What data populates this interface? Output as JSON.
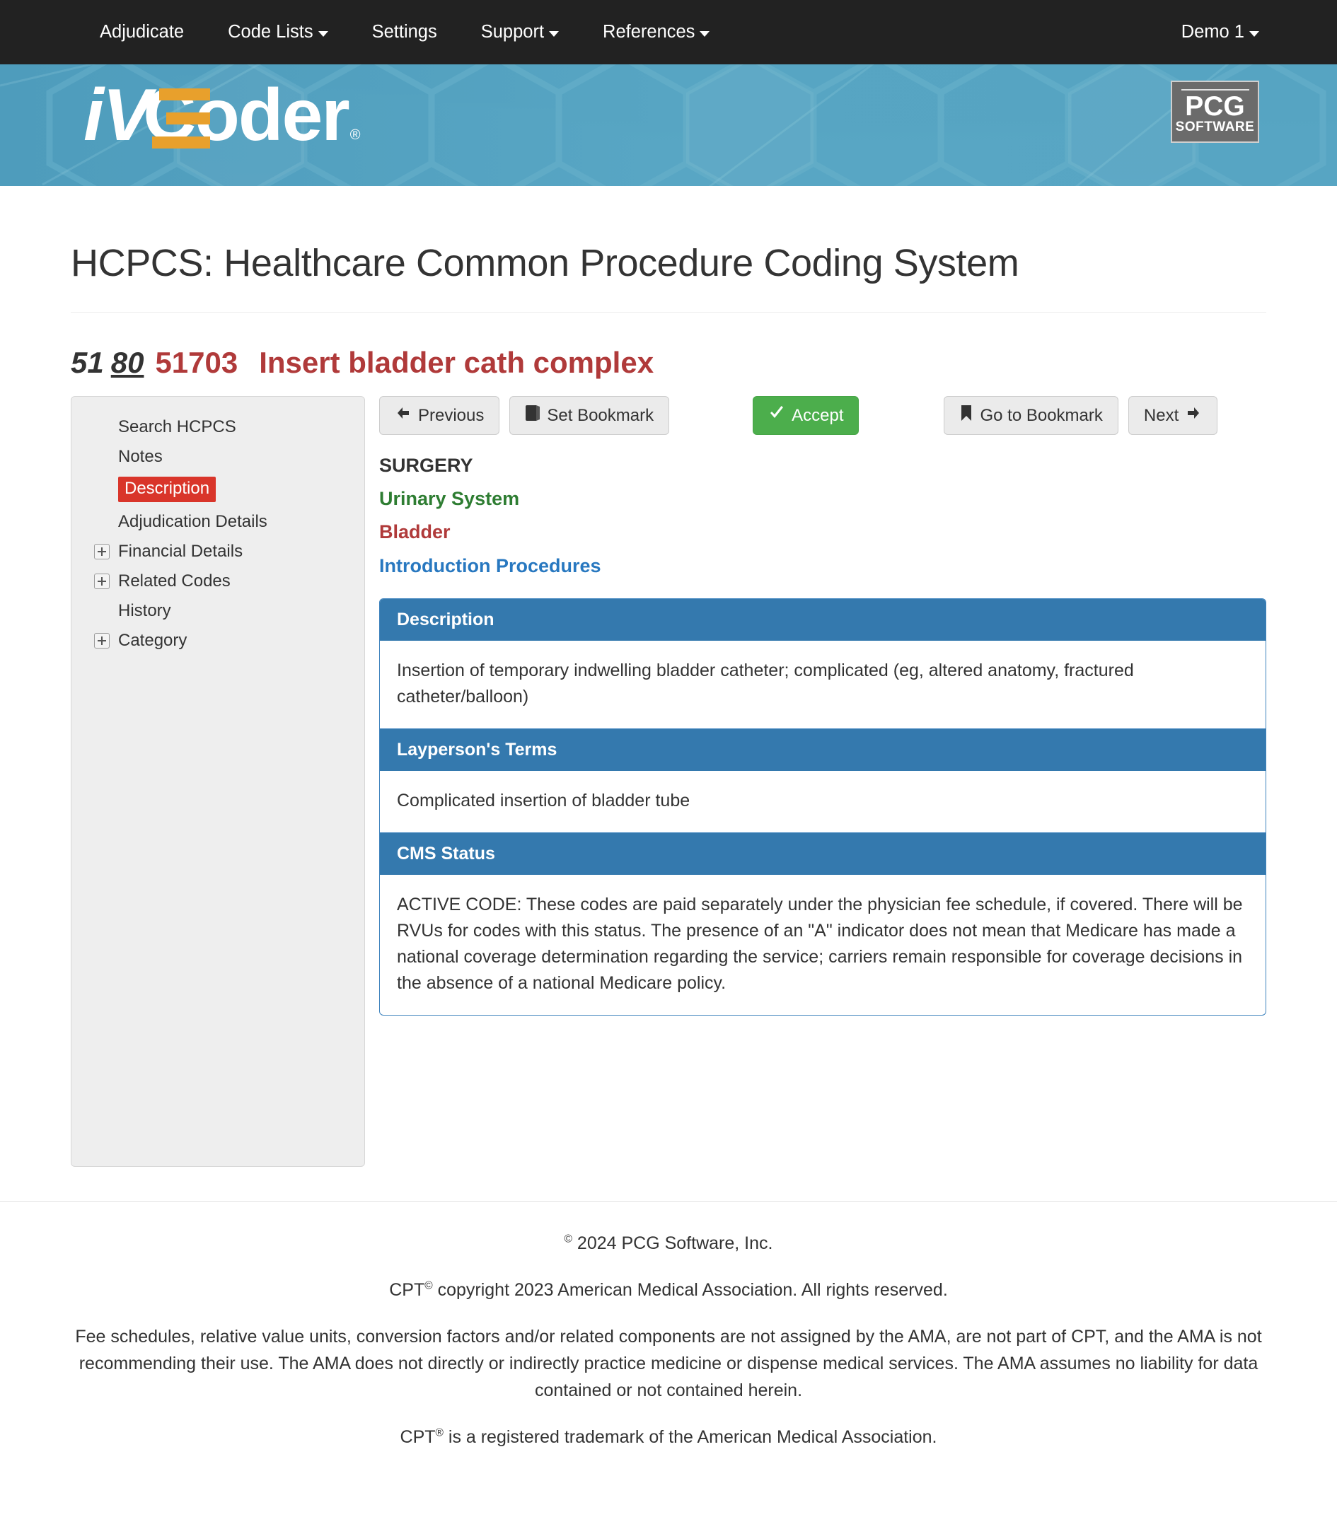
{
  "navbar": {
    "items": [
      {
        "label": "Adjudicate",
        "has_caret": false
      },
      {
        "label": "Code Lists",
        "has_caret": true
      },
      {
        "label": "Settings",
        "has_caret": false
      },
      {
        "label": "Support",
        "has_caret": true
      },
      {
        "label": "References",
        "has_caret": true
      }
    ],
    "user": {
      "label": "Demo 1",
      "has_caret": true
    }
  },
  "banner": {
    "logo_i": "i",
    "logo_v": "V",
    "logo_word": "Coder",
    "logo_reg": "®",
    "pcg_top": "PCG",
    "pcg_bottom": "SOFTWARE"
  },
  "page": {
    "title": "HCPCS: Healthcare Common Procedure Coding System"
  },
  "code_heading": {
    "modifier_1": "51",
    "modifier_2": "80",
    "code": "51703",
    "description": "Insert bladder cath complex"
  },
  "sidebar": {
    "items": [
      {
        "label": "Search HCPCS",
        "expandable": false,
        "active": false
      },
      {
        "label": "Notes",
        "expandable": false,
        "active": false
      },
      {
        "label": "Description",
        "expandable": false,
        "active": true
      },
      {
        "label": "Adjudication Details",
        "expandable": false,
        "active": false
      },
      {
        "label": "Financial Details",
        "expandable": true,
        "active": false
      },
      {
        "label": "Related Codes",
        "expandable": true,
        "active": false
      },
      {
        "label": "History",
        "expandable": false,
        "active": false
      },
      {
        "label": "Category",
        "expandable": true,
        "active": false
      }
    ]
  },
  "toolbar": {
    "previous": "Previous",
    "set_bookmark": "Set Bookmark",
    "accept": "Accept",
    "go_to_bookmark": "Go to Bookmark",
    "next": "Next"
  },
  "hierarchy": {
    "section": "SURGERY",
    "system": "Urinary System",
    "organ": "Bladder",
    "procedure_group": "Introduction Procedures"
  },
  "panels": [
    {
      "heading": "Description",
      "body": "Insertion of temporary indwelling bladder catheter; complicated (eg, altered anatomy, fractured catheter/balloon)"
    },
    {
      "heading": "Layperson's Terms",
      "body": "Complicated insertion of bladder tube"
    },
    {
      "heading": "CMS Status",
      "body": "ACTIVE CODE: These codes are paid separately under the physician fee schedule, if covered. There will be RVUs for codes with this status. The presence of an \"A\" indicator does not mean that Medicare has made a national coverage determination regarding the service; carriers remain responsible for coverage decisions in the absence of a national Medicare policy."
    }
  ],
  "footer": {
    "copyright_year": " 2024 PCG Software, Inc.",
    "cpt_copyright_pre": "CPT",
    "cpt_copyright_post": " copyright 2023 American Medical Association. All rights reserved.",
    "disclaimer": "Fee schedules, relative value units, conversion factors and/or related components are not assigned by the AMA, are not part of CPT, and the AMA is not recommending their use. The AMA does not directly or indirectly practice medicine or dispense medical services. The AMA assumes no liability for data contained or not contained herein.",
    "trademark_pre": "CPT",
    "trademark_post": " is a registered trademark of the American Medical Association.",
    "sup_copy": "©",
    "sup_reg": "®"
  },
  "colors": {
    "navbar_bg": "#222222",
    "banner_blue": "#56a4c2",
    "accent_orange": "#e8a02c",
    "panel_blue": "#3479ae",
    "active_red": "#d9352a",
    "code_maroon": "#b03a3a",
    "green": "#2e7d32",
    "link_blue": "#2878c0",
    "accept_green": "#4cae4c"
  }
}
